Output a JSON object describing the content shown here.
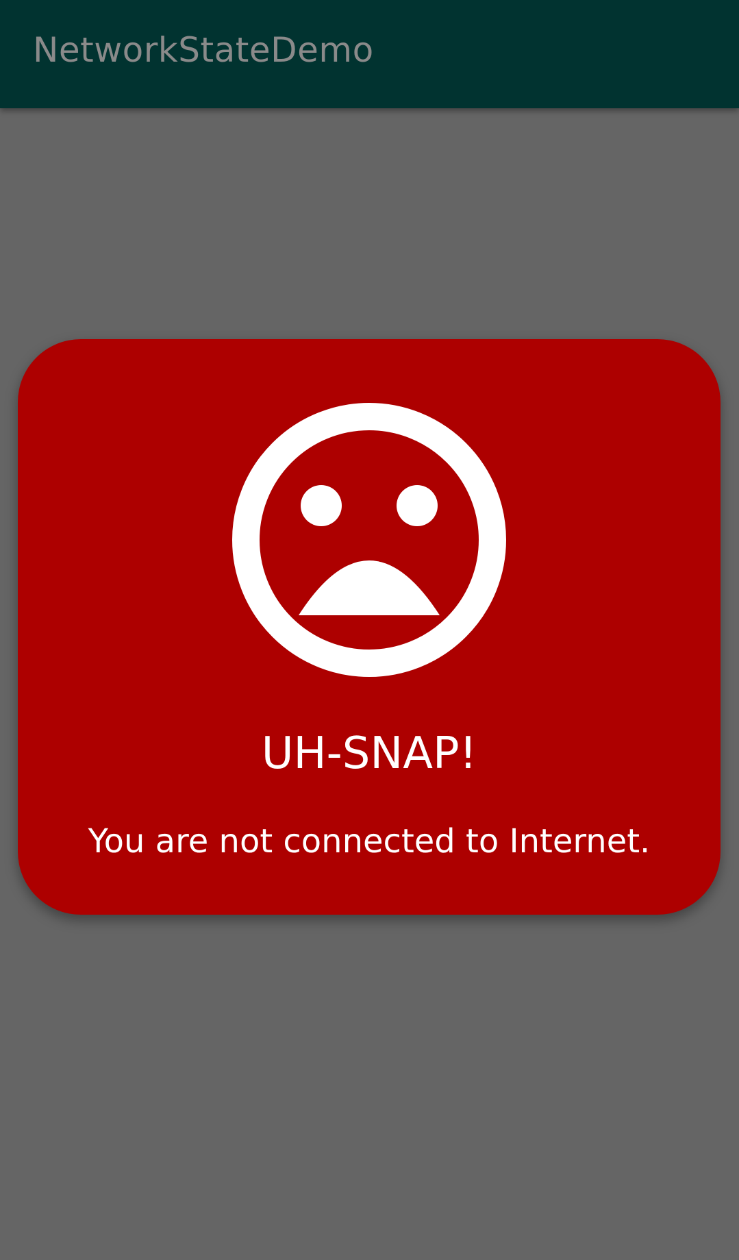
{
  "app_bar": {
    "title": "NetworkStateDemo",
    "background": "#013330"
  },
  "screen": {
    "background": "#656565"
  },
  "offline_card": {
    "background": "#ad0000",
    "icon": "sad-face-icon",
    "headline": "UH-SNAP!",
    "message": "You are not connected to Internet."
  }
}
